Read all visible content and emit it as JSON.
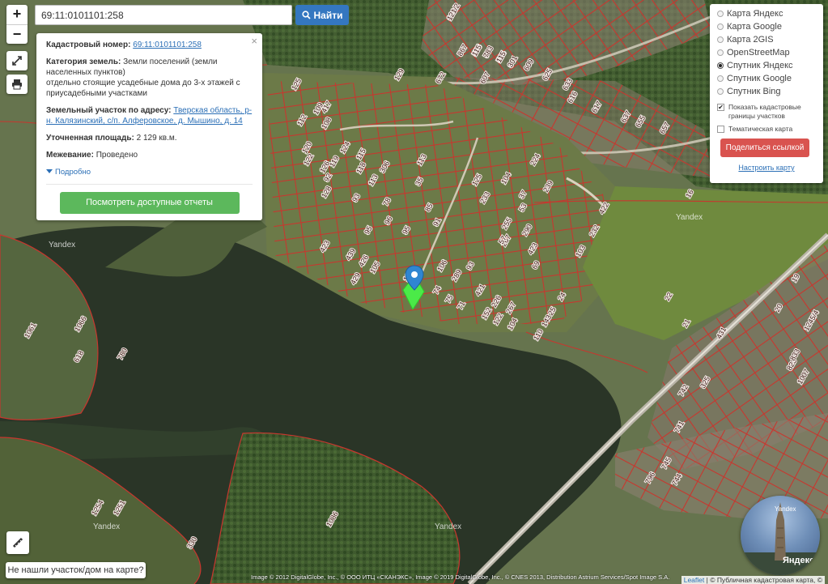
{
  "search": {
    "value": "69:11:0101101:258",
    "button_label": "Найти"
  },
  "info": {
    "cadastral_label": "Кадастровый номер:",
    "cadastral_value": "69:11:0101101:258",
    "category_label": "Категория земель:",
    "category_value": "Земли поселений (земли населенных пунктов)",
    "usage_value": "отдельно стоящие усадебные дома до 3-х этажей с приусадебными участками",
    "address_label": "Земельный участок по адресу:",
    "address_value": "Тверская область, р-н. Калязинский, с/п. Алферовское, д. Мышино, д. 14",
    "area_label": "Уточненная площадь:",
    "area_value": "2 129 кв.м.",
    "survey_label": "Межевание:",
    "survey_value": "Проведено",
    "more_label": "Подробно",
    "reports_button": "Посмотреть доступные отчеты",
    "close_symbol": "×"
  },
  "layers": {
    "options": [
      {
        "label": "Карта Яндекс",
        "selected": false
      },
      {
        "label": "Карта Google",
        "selected": false
      },
      {
        "label": "Карта 2GIS",
        "selected": false
      },
      {
        "label": "OpenStreetMap",
        "selected": false
      },
      {
        "label": "Спутник Яндекс",
        "selected": true
      },
      {
        "label": "Спутник Google",
        "selected": false
      },
      {
        "label": "Спутник Bing",
        "selected": false
      }
    ],
    "checkbox_borders": {
      "label": "Показать кадастровые границы участков",
      "checked": true
    },
    "checkbox_thematic": {
      "label": "Тематическая карта",
      "checked": false
    },
    "share_button": "Поделиться ссылкой",
    "setup_link": "Настроить карту"
  },
  "controls": {
    "zoom_in": "+",
    "zoom_out": "−"
  },
  "bottom": {
    "not_found_button": "Не нашли участок/дом на карте?",
    "attribution": "Image © 2012 DigitalGlobe, Inc., © ООО ИТЦ «СКАНЭКС», Image © 2019 DigitalGlobe, Inc., © CNES 2013, Distribution Astrium Services/Spot Image S.A.",
    "credit_leaflet": "Leaflet",
    "credit_rest": "| © Публичная кадастровая карта, ©",
    "yandex_widget_label": "Яндекс",
    "yandex_widget_small": "Yandex"
  },
  "map": {
    "watermarks": [
      "Yandex",
      "Yandex",
      "Yandex",
      "Yandex"
    ],
    "plot_numbers": [
      "669",
      "567",
      "576",
      "583",
      "594",
      "601",
      "609",
      "625",
      "633",
      "129",
      "672",
      "607",
      "616",
      "617",
      "637",
      "655",
      "657",
      "125",
      "112",
      "120",
      "417",
      "108",
      "124",
      "109",
      "122",
      "119",
      "92",
      "128",
      "126",
      "115",
      "118",
      "113",
      "423",
      "93",
      "78",
      "96",
      "95",
      "95",
      "85",
      "91",
      "439",
      "426",
      "105",
      "429",
      "113",
      "115",
      "106",
      "306",
      "35",
      "125",
      "104",
      "224",
      "37",
      "239",
      "53",
      "233",
      "255",
      "290",
      "267",
      "289",
      "93",
      "57",
      "423",
      "69",
      "103",
      "232",
      "422",
      "421",
      "226",
      "267",
      "74",
      "75",
      "71",
      "152",
      "122",
      "104",
      "110",
      "143",
      "25",
      "24",
      "16",
      "19",
      "22",
      "21",
      "431",
      "20",
      "1245/4",
      "1007",
      "823",
      "833",
      "325",
      "742",
      "741",
      "745",
      "796",
      "744",
      "330",
      "1251",
      "1254",
      "1086",
      "1061",
      "1066",
      "618",
      "780",
      "121/2",
      "8",
      "115",
      "7",
      "115",
      "3"
    ]
  }
}
